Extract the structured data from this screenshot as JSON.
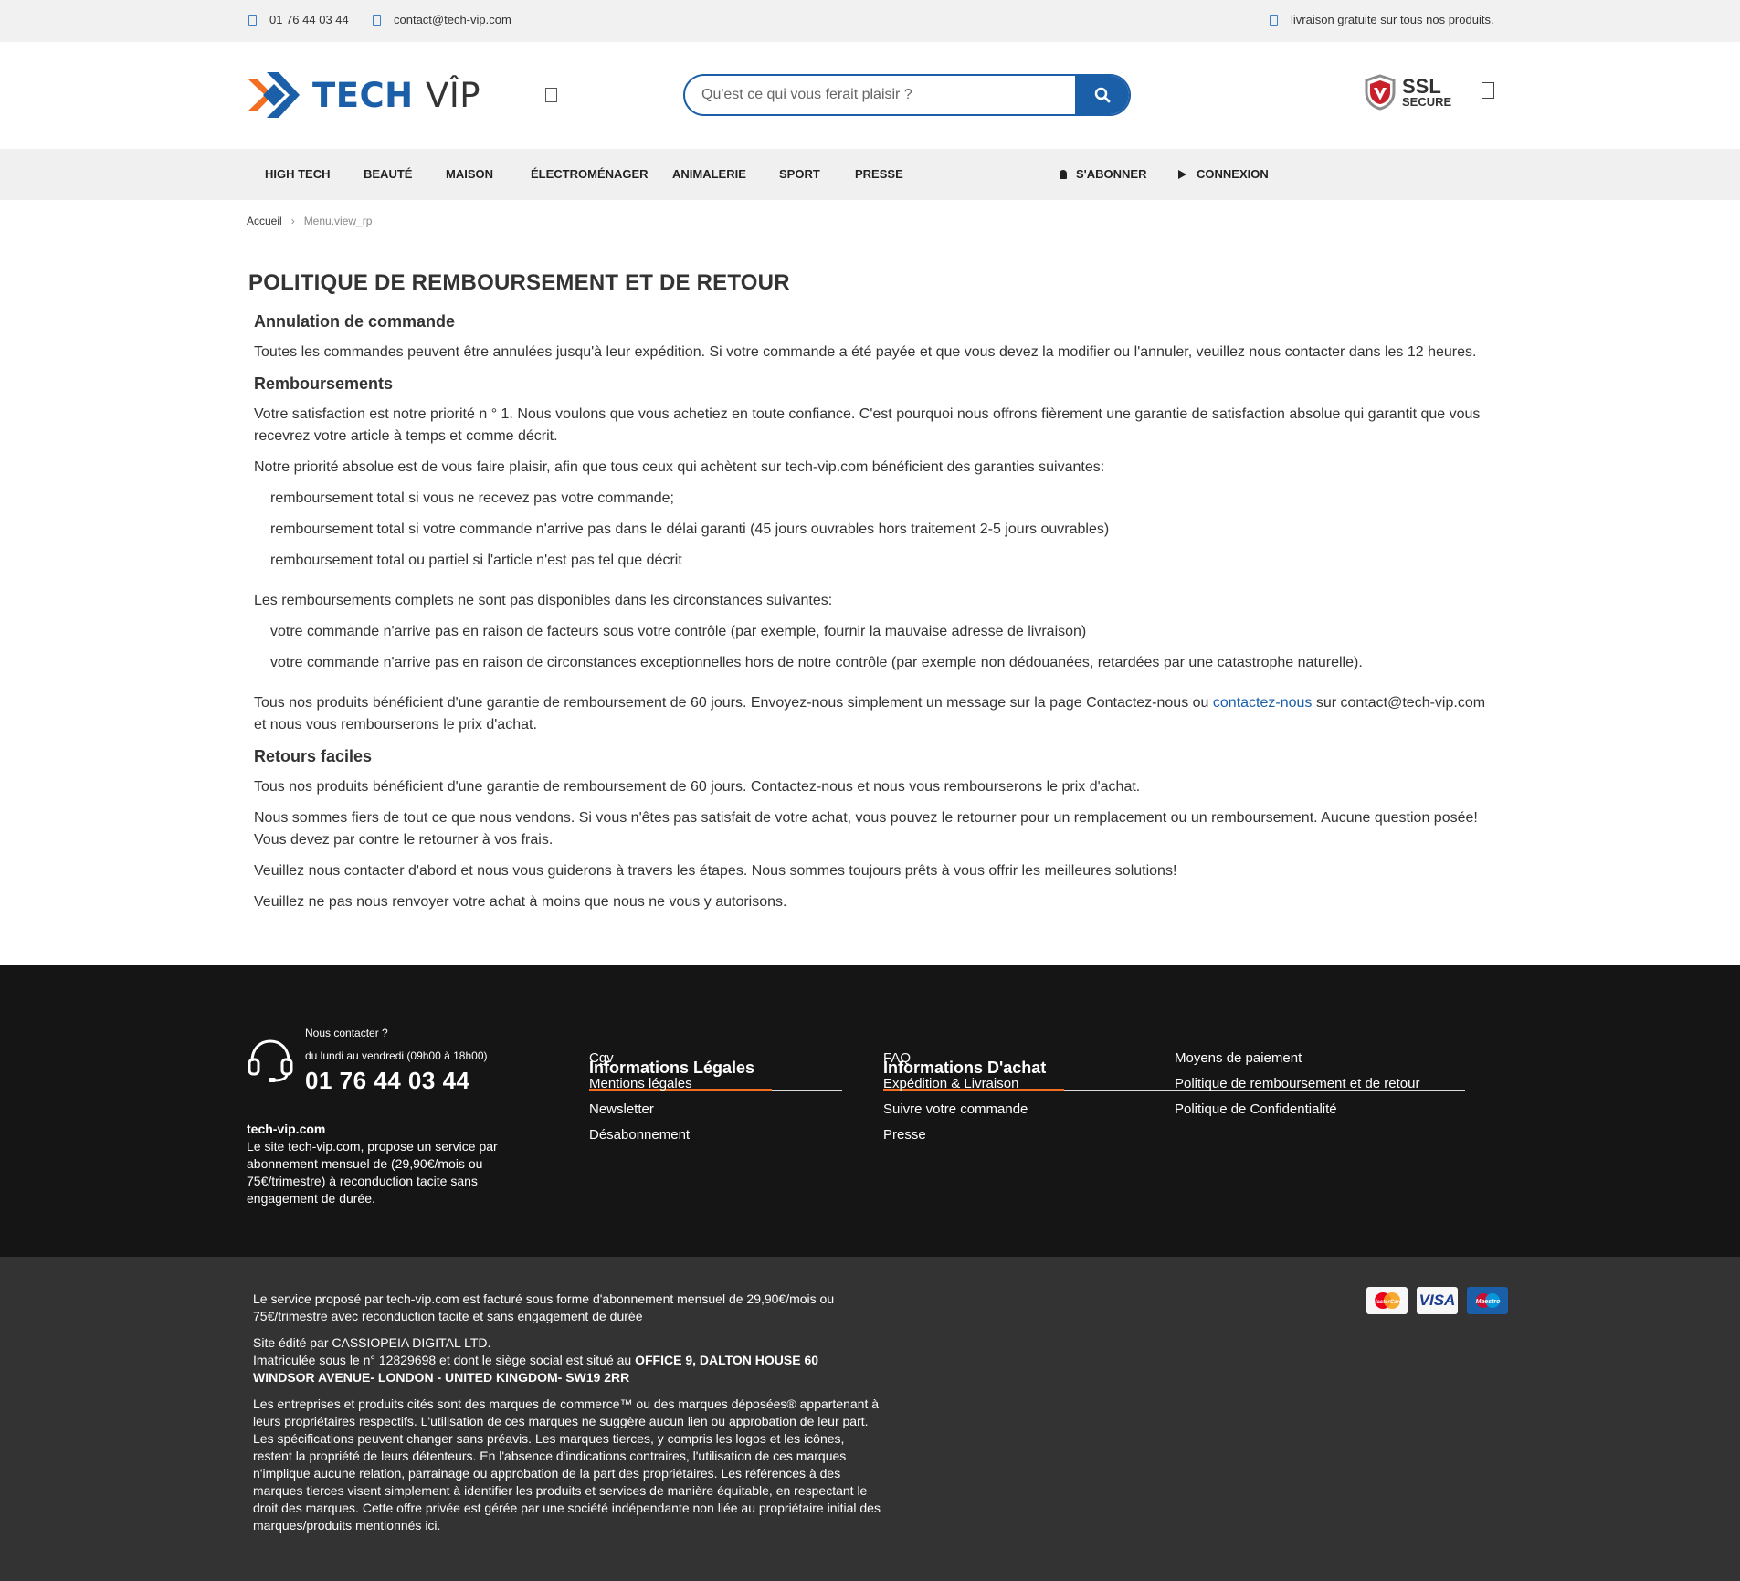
{
  "topbar": {
    "phone": "01 76 44 03 44",
    "email": "contact@tech-vip.com",
    "shipping": "livraison gratuite sur tous nos produits."
  },
  "header": {
    "logo_tech": "TECH",
    "logo_vip": "VÎP",
    "search_placeholder": "Qu'est ce qui vous ferait plaisir ?",
    "ssl_title": "SSL",
    "ssl_subtitle": "SECURE"
  },
  "nav": {
    "items": [
      "High Tech",
      "Beauté",
      "Maison",
      "Électroménager",
      "Animalerie",
      "Sport",
      "Presse"
    ],
    "subscribe": "S'abonner",
    "login": "Connexion"
  },
  "breadcrumb": {
    "home": "Accueil",
    "current": "Menu.view_rp"
  },
  "main": {
    "title": "POLITIQUE DE REMBOURSEMENT ET DE RETOUR",
    "s1_title": "Annulation de commande",
    "s1_p1": "Toutes les commandes peuvent être annulées jusqu'à leur expédition. Si votre commande a été payée et que vous devez la modifier ou l'annuler, veuillez nous contacter dans les 12 heures.",
    "s2_title": "Remboursements",
    "s2_p1": "Votre satisfaction est notre priorité n ° 1. Nous voulons que vous achetiez en toute confiance. C'est pourquoi nous offrons fièrement une garantie de satisfaction absolue qui garantit que vous recevrez votre article à temps et comme décrit.",
    "s2_p2": "Notre priorité absolue est de vous faire plaisir, afin que tous ceux qui achètent sur tech-vip.com bénéficient des garanties suivantes:",
    "s2_list1": [
      "remboursement total si vous ne recevez pas votre commande;",
      "remboursement total si votre commande n'arrive pas dans le délai garanti (45 jours ouvrables hors traitement 2-5 jours ouvrables)",
      "remboursement total ou partiel si l'article n'est pas tel que décrit"
    ],
    "s2_p3": "Les remboursements complets ne sont pas disponibles dans les circonstances suivantes:",
    "s2_list2": [
      "votre commande n'arrive pas en raison de facteurs sous votre contrôle (par exemple, fournir la mauvaise adresse de livraison)",
      "votre commande n'arrive pas en raison de circonstances exceptionnelles hors de notre contrôle (par exemple non dédouanées, retardées par une catastrophe naturelle)."
    ],
    "s2_p4_a": "Tous nos produits bénéficient d'une garantie de remboursement de 60 jours. Envoyez-nous simplement un message sur la page Contactez-nous ou ",
    "s2_p4_link": "contactez-nous",
    "s2_p4_b": " sur contact@tech-vip.com et nous vous rembourserons le prix d'achat.",
    "s3_title": "Retours faciles",
    "s3_p1": "Tous nos produits bénéficient d'une garantie de remboursement de 60 jours. Contactez-nous et nous vous rembourserons le prix d'achat.",
    "s3_p2": "Nous sommes fiers de tout ce que nous vendons. Si vous n'êtes pas satisfait de votre achat, vous pouvez le retourner pour un remplacement ou un remboursement. Aucune question posée! Vous devez par contre le retourner à vos frais.",
    "s3_p3": "Veuillez nous contacter d'abord et nous vous guiderons à travers les étapes. Nous sommes toujours prêts à vous offrir les meilleures solutions!",
    "s3_p4": "Veuillez ne pas nous renvoyer votre achat à moins que nous ne vous y autorisons."
  },
  "footer": {
    "contact_label": "Nous contacter ?",
    "contact_hours": "du lundi au vendredi (09h00 à 18h00)",
    "contact_phone": "01 76 44 03 44",
    "site_name": "tech-vip.com",
    "site_desc": "Le site tech-vip.com, propose un service par abonnement mensuel de (29,90€/mois ou 75€/trimestre) à reconduction tacite sans engagement de durée.",
    "legal_title": "Informations Légales",
    "legal_links": [
      "Cgv",
      "Mentions légales",
      "Newsletter",
      "Désabonnement"
    ],
    "purchase_title": "Informations D'achat",
    "purchase_links_col1": [
      "FAQ",
      "Expédition & Livraison",
      "Suivre votre commande",
      "Presse"
    ],
    "purchase_links_col2": [
      "Moyens de paiement",
      "Politique de remboursement et de retour",
      "Politique de Confidentialité"
    ]
  },
  "bottom": {
    "p1": "Le service proposé par tech-vip.com est facturé sous forme d'abonnement mensuel de 29,90€/mois ou 75€/trimestre avec reconduction tacite et sans engagement de durée",
    "p2_line1": "Site édité par CASSIOPEIA DIGITAL LTD.",
    "p2_line2": "Imatriculée sous le n° 12829698 et dont le siège social est situé au ",
    "p2_address": "OFFICE 9, DALTON HOUSE 60 WINDSOR AVENUE- LONDON - UNITED KINGDOM- SW19 2RR",
    "p3": "Les entreprises et produits cités sont des marques de commerce™ ou des marques déposées® appartenant à leurs propriétaires respectifs. L'utilisation de ces marques ne suggère aucun lien ou approbation de leur part. Les spécifications peuvent changer sans préavis. Les marques tierces, y compris les logos et les icônes, restent la propriété de leurs détenteurs. En l'absence d'indications contraires, l'utilisation de ces marques n'implique aucune relation, parrainage ou approbation de la part des propriétaires. Les références à des marques tierces visent simplement à identifier les produits et services de manière équitable, en respectant le droit des marques. Cette offre privée est gérée par une société indépendante non liée au propriétaire initial des marques/produits mentionnés ici.",
    "card_mastercard": "MasterCard",
    "card_visa": "VISA",
    "card_maestro": "Maestro"
  }
}
